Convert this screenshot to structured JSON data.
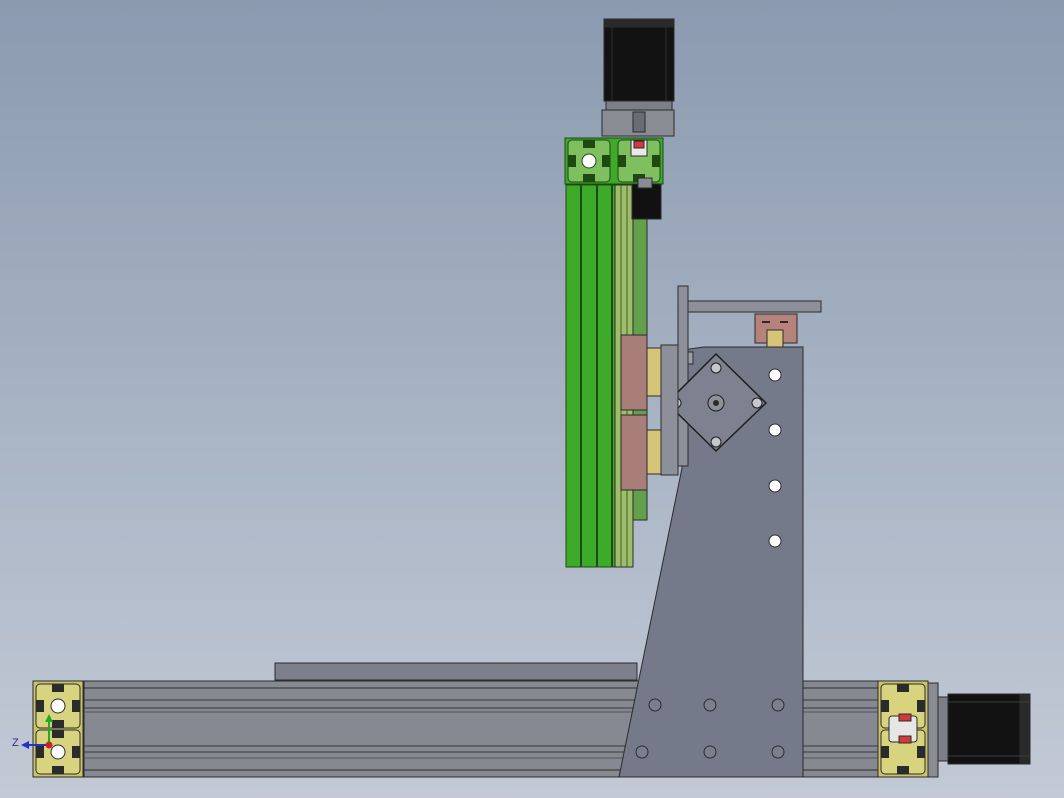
{
  "viewport": {
    "background_top": "#8b9ab0",
    "background_bottom": "#c3cad6"
  },
  "colors": {
    "aluminum_profile": "#85878f",
    "profile_endcap": "#c7c26a",
    "z_rail_green": "#3dae2b",
    "stepper_body": "#111111",
    "stepper_flange": "#8a8c94",
    "gantry_plate": "#757a8b",
    "carriage_block": "#a97d78",
    "coupler_red": "#d13a3a",
    "axis_x": "#cc2222",
    "axis_y": "#22aa22",
    "axis_z": "#2233cc"
  },
  "axis_triad": {
    "label": "Z"
  }
}
